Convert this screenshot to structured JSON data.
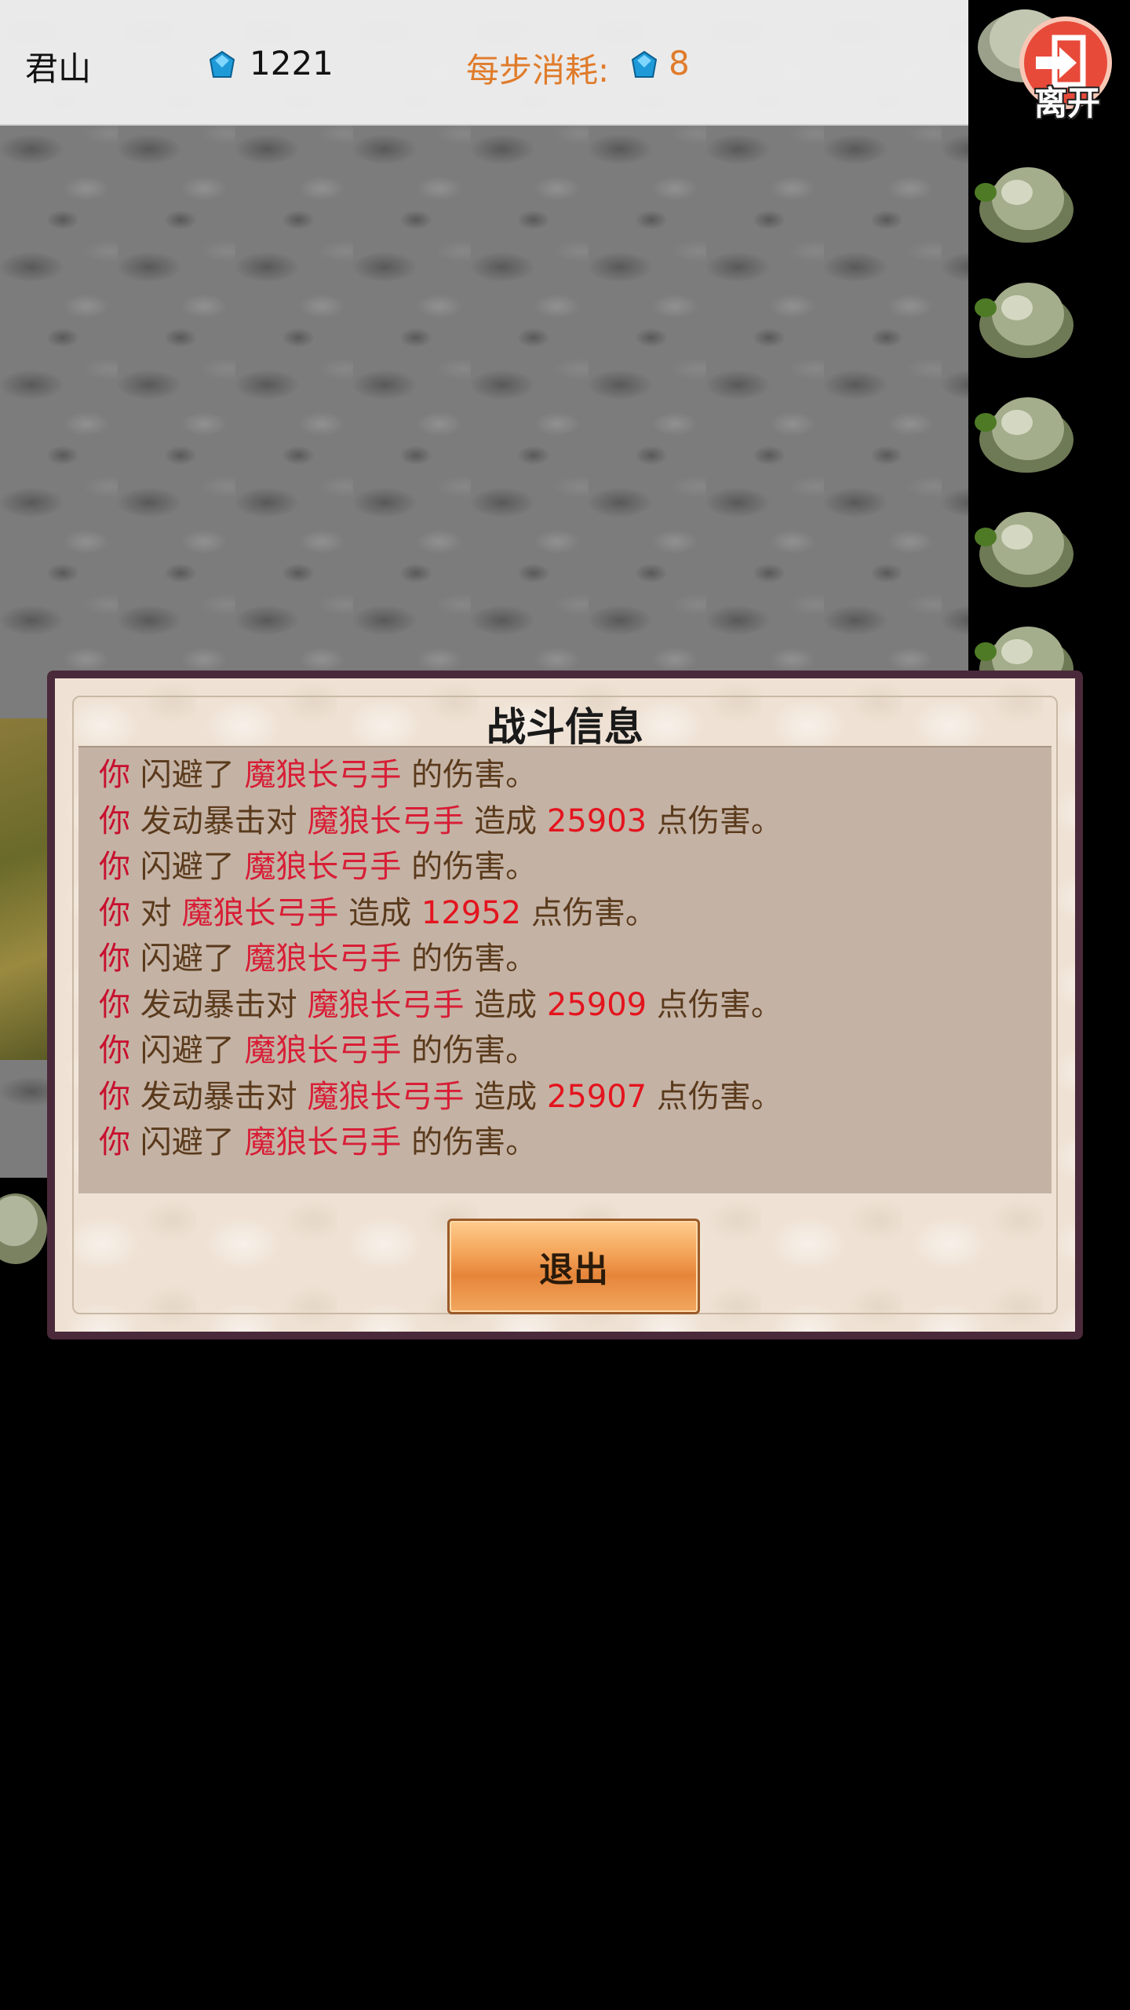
{
  "topbar": {
    "location": "君山",
    "gems": "1221",
    "step_cost_label": "每步消耗:",
    "step_cost_value": "8",
    "leave_label": "离开"
  },
  "dialog": {
    "title": "战斗信息",
    "exit_label": "退出",
    "log": [
      {
        "who": "你",
        "verb": "闪避了",
        "enemy": "魔狼长弓手",
        "tail": "的伤害。"
      },
      {
        "who": "你",
        "verb": "发动暴击对",
        "enemy": "魔狼长弓手",
        "mid": "造成",
        "num": "25903",
        "tail": "点伤害。"
      },
      {
        "who": "你",
        "verb": "闪避了",
        "enemy": "魔狼长弓手",
        "tail": "的伤害。"
      },
      {
        "who": "你",
        "verb": "对",
        "enemy": "魔狼长弓手",
        "mid": "造成",
        "num": "12952",
        "tail": "点伤害。"
      },
      {
        "who": "你",
        "verb": "闪避了",
        "enemy": "魔狼长弓手",
        "tail": "的伤害。"
      },
      {
        "who": "你",
        "verb": "发动暴击对",
        "enemy": "魔狼长弓手",
        "mid": "造成",
        "num": "25909",
        "tail": "点伤害。"
      },
      {
        "who": "你",
        "verb": "闪避了",
        "enemy": "魔狼长弓手",
        "tail": "的伤害。"
      },
      {
        "who": "你",
        "verb": "发动暴击对",
        "enemy": "魔狼长弓手",
        "mid": "造成",
        "num": "25907",
        "tail": "点伤害。"
      },
      {
        "who": "你",
        "verb": "闪避了",
        "enemy": "魔狼长弓手",
        "tail": "的伤害。"
      }
    ]
  },
  "colors": {
    "accent_orange": "#e07b2a",
    "log_red": "#c8102e",
    "log_brown": "#5a3a1c",
    "dialog_border": "#4a2a3a"
  },
  "icons": [
    "gem-icon",
    "leave-icon",
    "rock-icon"
  ]
}
